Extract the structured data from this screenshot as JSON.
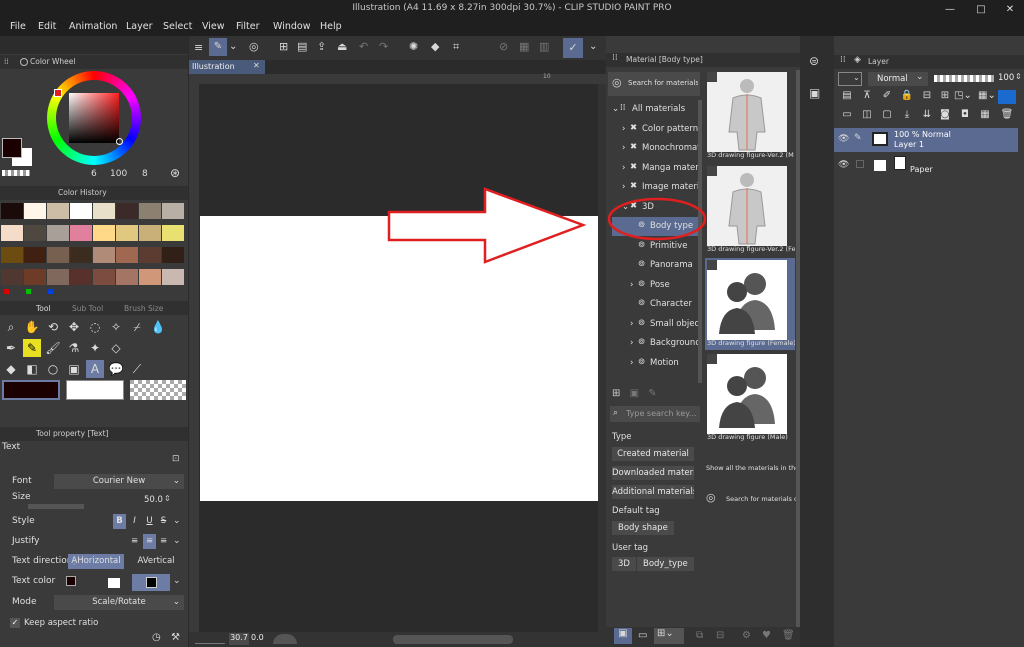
{
  "window": {
    "title": "Illustration (A4 11.69 x 8.27in 300dpi 30.7%)  - CLIP STUDIO PAINT PRO",
    "minimize": "—",
    "maximize": "□",
    "close": "✕"
  },
  "menu": [
    "File",
    "Edit",
    "Animation",
    "Layer",
    "Select",
    "View",
    "Filter",
    "Window",
    "Help"
  ],
  "color_wheel": {
    "header": "Color Wheel",
    "readout": [
      "6",
      "100",
      "8"
    ]
  },
  "color_history": {
    "header": "Color History",
    "swatches": [
      "#1a0a0a",
      "#fff6ea",
      "#cdbda7",
      "#ffffff",
      "#e8e0c8",
      "#3c2a28",
      "#8c8070",
      "#b8b0a4",
      "#f4dcc8",
      "#4e4840",
      "#a8a098",
      "#e0809c",
      "#ffd888",
      "#e0c880",
      "#c8b078",
      "#e8e070",
      "#6c4c10",
      "#402010",
      "#786050",
      "#3c2c20",
      "#b08c78",
      "#a06850",
      "#5c3c30",
      "#302018",
      "#503830",
      "#6c3c28",
      "#80685c",
      "#58302c",
      "#7c4c40",
      "#a47464",
      "#d09878",
      "#c8b8b0"
    ]
  },
  "tool_palette": {
    "tabs": [
      "Tool",
      "Sub Tool",
      "Brush Size"
    ],
    "icons": [
      "magnifier-icon",
      "hand-icon",
      "rotate-icon",
      "move-icon",
      "lasso-icon",
      "wand-icon",
      "eyedropper-icon",
      "drop-icon",
      "pen-icon",
      "pencil-icon",
      "brush-icon",
      "airbrush-icon",
      "sparkle-icon",
      "eraser-icon",
      "fill-icon",
      "gradient-icon",
      "shape-icon",
      "frame-icon",
      "text-icon",
      "balloon-icon",
      "ruler-icon"
    ]
  },
  "tool_property": {
    "header": "Tool property [Text]",
    "name": "Text",
    "font_label": "Font",
    "font_value": "Courier New",
    "size_label": "Size",
    "size_value": "50.0",
    "style_label": "Style",
    "style_bold": "B",
    "style_italic": "I",
    "style_underline": "U",
    "style_strike": "S",
    "justify_label": "Justify",
    "direction_label": "Text direction",
    "direction_horizontal": "Horizontal",
    "direction_vertical": "Vertical",
    "color_label": "Text color",
    "mode_label": "Mode",
    "mode_value": "Scale/Rotate",
    "keep_aspect": "Keep aspect ratio"
  },
  "document": {
    "tab": "Illustration",
    "ruler_mark": "10",
    "zoom": "30.7",
    "rotation": "0.0"
  },
  "material": {
    "header": "Material [Body type]",
    "search_link": "Search for materials on",
    "tree": [
      {
        "label": "All materials",
        "indent": 0,
        "expanded": true
      },
      {
        "label": "Color pattern",
        "indent": 1
      },
      {
        "label": "Monochromatic",
        "indent": 1
      },
      {
        "label": "Manga material",
        "indent": 1
      },
      {
        "label": "Image material",
        "indent": 1
      },
      {
        "label": "3D",
        "indent": 1,
        "expanded": true
      },
      {
        "label": "Body type",
        "indent": 2,
        "selected": true
      },
      {
        "label": "Primitive",
        "indent": 2
      },
      {
        "label": "Panorama",
        "indent": 2
      },
      {
        "label": "Pose",
        "indent": 2
      },
      {
        "label": "Character",
        "indent": 2
      },
      {
        "label": "Small object",
        "indent": 2
      },
      {
        "label": "Background",
        "indent": 2
      },
      {
        "label": "Motion",
        "indent": 2
      }
    ],
    "thumbnails": [
      {
        "caption": "3D drawing figure-Ver.2 (M",
        "kind": "figure"
      },
      {
        "caption": "3D drawing figure-Ver.2 (Fe",
        "kind": "figure"
      },
      {
        "caption": "3D drawing figure (Female)",
        "kind": "silhouette",
        "selected": true
      },
      {
        "caption": "3D drawing figure (Male)",
        "kind": "silhouette"
      }
    ],
    "show_all_text": "Show all the materials in the fo",
    "search_materials_text": "Search for materials on",
    "search_placeholder": "Type search key...",
    "type_label": "Type",
    "type_buttons": [
      "Created material",
      "Downloaded material",
      "Additional materials"
    ],
    "default_tag_label": "Default tag",
    "default_tags": [
      "Body shape"
    ],
    "user_tag_label": "User tag",
    "user_tags": [
      "3D",
      "Body_type"
    ]
  },
  "layer": {
    "header": "Layer",
    "blend_mode": "Normal",
    "opacity": "100",
    "layers": [
      {
        "line1": "100 % Normal",
        "line2": "Layer 1",
        "selected": true
      },
      {
        "line1": "",
        "line2": "Paper",
        "selected": false
      }
    ]
  },
  "colors": {
    "accent": "#6c7ca4",
    "selection": "#5a6a90",
    "annotation_red": "#e02020"
  }
}
